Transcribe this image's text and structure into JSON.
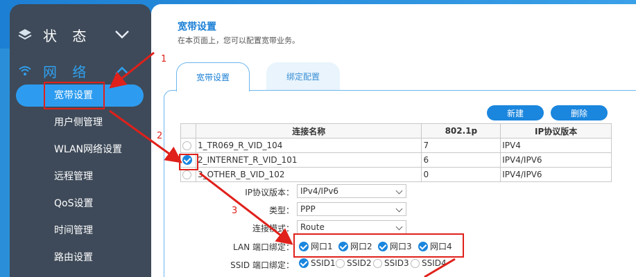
{
  "sidebar": {
    "status_label": "状 态",
    "network_label": "网 络",
    "items": [
      {
        "label": "宽带设置"
      },
      {
        "label": "用户侧管理"
      },
      {
        "label": "WLAN网络设置"
      },
      {
        "label": "远程管理"
      },
      {
        "label": "QoS设置"
      },
      {
        "label": "时间管理"
      },
      {
        "label": "路由设置"
      }
    ]
  },
  "main": {
    "title": "宽带设置",
    "description": "在本页面上，您可以配置宽带业务。",
    "tabs": [
      {
        "label": "宽带设置",
        "active": true
      },
      {
        "label": "绑定配置",
        "active": false
      }
    ],
    "buttons": {
      "new": "新建",
      "delete": "删除"
    },
    "table": {
      "headers": [
        "连接名称",
        "802.1p",
        "IP协议版本"
      ],
      "rows": [
        {
          "name": "1_TR069_R_VID_104",
          "p8021": "7",
          "ip": "IPV4",
          "selected": false
        },
        {
          "name": "2_INTERNET_R_VID_101",
          "p8021": "6",
          "ip": "IPV4/IPV6",
          "selected": true
        },
        {
          "name": "3_OTHER_B_VID_102",
          "p8021": "0",
          "ip": "IPV4/IPV6",
          "selected": false
        }
      ]
    },
    "form": {
      "ip_version": {
        "label": "IP协议版本：",
        "value": "IPv4/IPv6"
      },
      "type": {
        "label": "类型：",
        "value": "PPP"
      },
      "connection_mode": {
        "label": "连接模式：",
        "value": "Route"
      },
      "lan_binding": {
        "label": "LAN 端口绑定：",
        "ports": [
          {
            "label": "网口1",
            "checked": true
          },
          {
            "label": "网口2",
            "checked": true
          },
          {
            "label": "网口3",
            "checked": true
          },
          {
            "label": "网口4",
            "checked": true
          }
        ]
      },
      "ssid_binding": {
        "label": "SSID 端口绑定：",
        "ssids": [
          {
            "label": "SSID1",
            "checked": true
          },
          {
            "label": "SSID2",
            "checked": false
          },
          {
            "label": "SSID3",
            "checked": false
          },
          {
            "label": "SSID4",
            "checked": false
          }
        ]
      }
    }
  },
  "annotations": [
    "1",
    "2",
    "3"
  ],
  "colors": {
    "accent": "#1a86de",
    "sidebar": "#3e4a59",
    "annotation": "#e0201a"
  }
}
